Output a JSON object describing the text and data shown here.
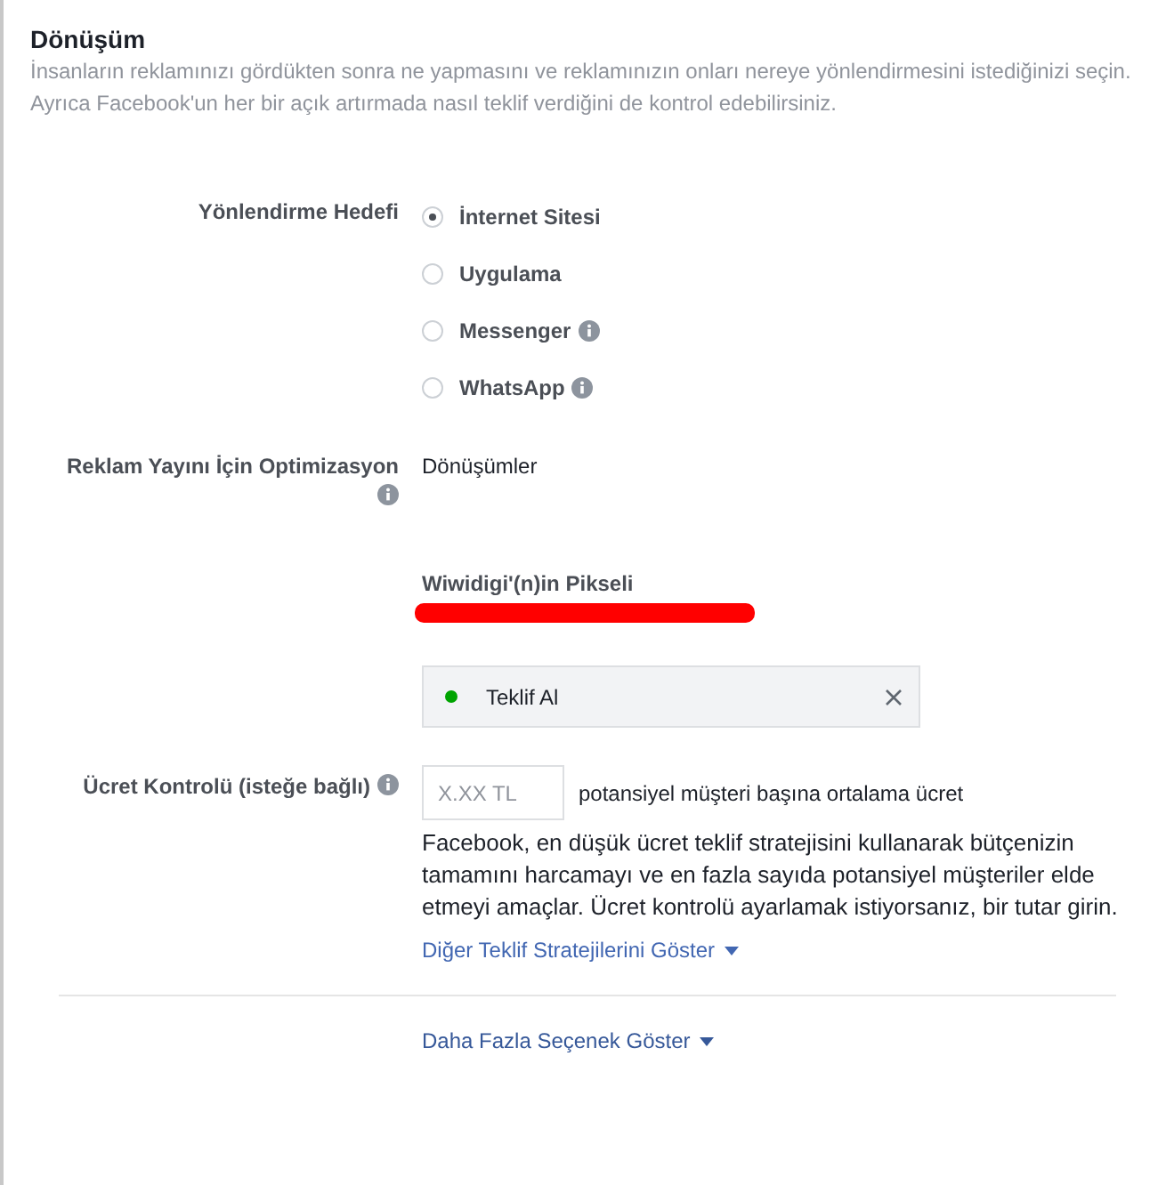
{
  "section": {
    "title": "Dönüşüm",
    "description": "İnsanların reklamınızı gördükten sonra ne yapmasını ve reklamınızın onları nereye yönlendirmesini istediğinizi seçin. Ayrıca Facebook'un her bir açık artırmada nasıl teklif verdiğini de kontrol edebilirsiniz."
  },
  "destination": {
    "label": "Yönlendirme Hedefi",
    "options": [
      {
        "label": "İnternet Sitesi",
        "selected": true,
        "info": false
      },
      {
        "label": "Uygulama",
        "selected": false,
        "info": false
      },
      {
        "label": "Messenger",
        "selected": false,
        "info": true
      },
      {
        "label": "WhatsApp",
        "selected": false,
        "info": true
      }
    ]
  },
  "optimization": {
    "label": "Reklam Yayını İçin Optimizasyon",
    "value": "Dönüşümler"
  },
  "pixel": {
    "label": "Wiwidigi'(n)in Pikseli",
    "event": {
      "label": "Teklif Al",
      "color": "#00a400"
    }
  },
  "cost_control": {
    "label": "Ücret Kontrolü (isteğe bağlı)",
    "placeholder": "X.XX TL",
    "suffix": "potansiyel müşteri başına ortalama ücret",
    "help": "Facebook, en düşük ücret teklif stratejisini kullanarak bütçenizin tamamını harcamayı ve en fazla sayıda potansiyel müşteriler elde etmeyi amaçlar. Ücret kontrolü ayarlamak istiyorsanız, bir tutar girin.",
    "link": "Diğer Teklif Stratejilerini Göster"
  },
  "more_link": "Daha Fazla Seçenek Göster"
}
